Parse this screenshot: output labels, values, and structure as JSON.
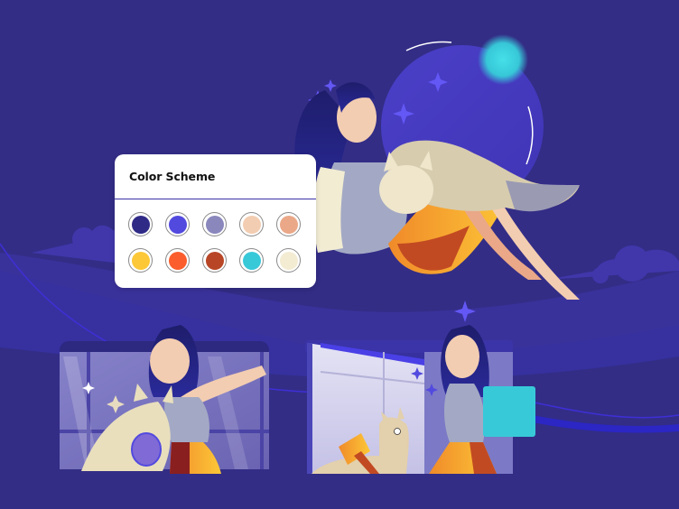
{
  "card": {
    "title": "Color Scheme",
    "swatches": [
      {
        "name": "deep-indigo",
        "color": "#2f2a86"
      },
      {
        "name": "royal-blue",
        "color": "#5249df"
      },
      {
        "name": "lavender-grey",
        "color": "#8a87bd"
      },
      {
        "name": "peach",
        "color": "#f3cdb1"
      },
      {
        "name": "apricot",
        "color": "#eaa888"
      },
      {
        "name": "sunflower",
        "color": "#fdc837"
      },
      {
        "name": "tangerine",
        "color": "#fb5d2c"
      },
      {
        "name": "rust",
        "color": "#b84626"
      },
      {
        "name": "turquoise",
        "color": "#38c9d9"
      },
      {
        "name": "cream",
        "color": "#f3ecd3"
      }
    ]
  },
  "scene": {
    "background": "#332d86",
    "hill_color": "#3b33a0",
    "cloud_color": "#4137ab",
    "moon_color": "#4b40cc",
    "orb_color": "#3fd6e0",
    "sparkle_color": "#5a4ff0"
  }
}
